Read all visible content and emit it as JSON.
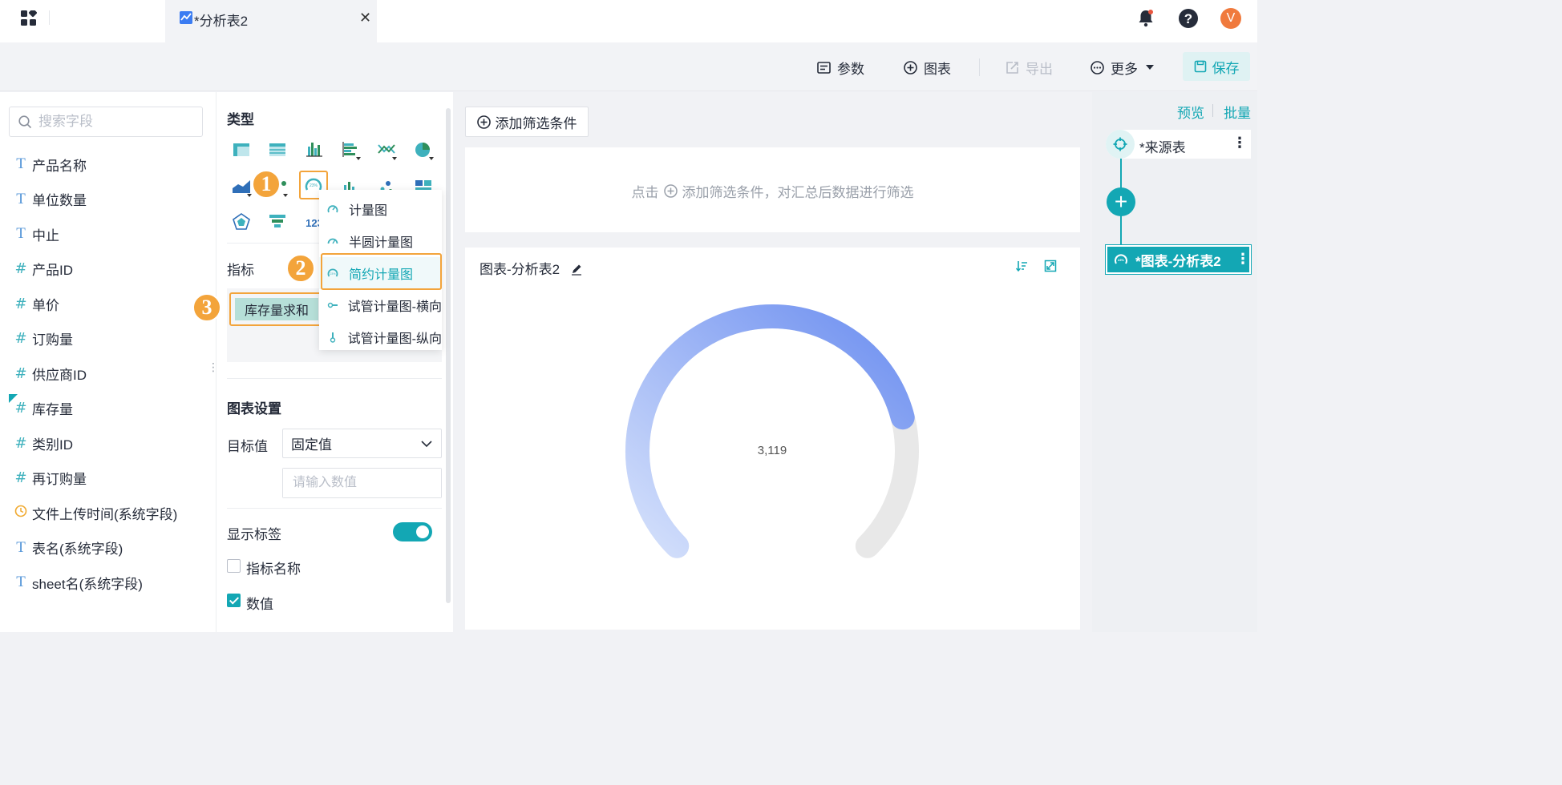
{
  "tab": {
    "title": "*分析表2"
  },
  "user": {
    "avatar_letter": "V"
  },
  "toolbar": {
    "params_label": "参数",
    "chart_label": "图表",
    "export_label": "导出",
    "more_label": "更多",
    "save_label": "保存"
  },
  "fields": {
    "search_placeholder": "搜索字段",
    "items": [
      {
        "type": "text",
        "label": "产品名称"
      },
      {
        "type": "text",
        "label": "单位数量"
      },
      {
        "type": "text",
        "label": "中止"
      },
      {
        "type": "number",
        "label": "产品ID"
      },
      {
        "type": "number",
        "label": "单价"
      },
      {
        "type": "number",
        "label": "订购量"
      },
      {
        "type": "number",
        "label": "供应商ID"
      },
      {
        "type": "number",
        "label": "库存量"
      },
      {
        "type": "number",
        "label": "类别ID"
      },
      {
        "type": "number",
        "label": "再订购量"
      },
      {
        "type": "time",
        "label": "文件上传时间(系统字段)"
      },
      {
        "type": "text",
        "label": "表名(系统字段)"
      },
      {
        "type": "text",
        "label": "sheet名(系统字段)"
      }
    ]
  },
  "config": {
    "type_title": "类型",
    "metric_title": "指标",
    "metric_chip": "库存量求和",
    "chart_settings_title": "图表设置",
    "target_label": "目标值",
    "target_value": "固定值",
    "number_placeholder": "请输入数值",
    "show_label_label": "显示标签",
    "metric_name_label": "指标名称",
    "value_label": "数值",
    "metric_name_checked": false,
    "value_checked": true,
    "show_label_on": true
  },
  "dropdown": {
    "items": [
      {
        "label": "计量图",
        "active": false
      },
      {
        "label": "半圆计量图",
        "active": false
      },
      {
        "label": "简约计量图",
        "active": true
      },
      {
        "label": "试管计量图-横向",
        "active": false
      },
      {
        "label": "试管计量图-纵向",
        "active": false
      }
    ]
  },
  "steps": [
    "1",
    "2",
    "3"
  ],
  "filter": {
    "add_label": "添加筛选条件",
    "hint_prefix": "点击",
    "hint_suffix": "添加筛选条件，对汇总后数据进行筛选"
  },
  "chart_data": {
    "type": "gauge",
    "title": "图表-分析表2",
    "value": 3119,
    "value_label": "3,119",
    "fill_fraction": 0.78,
    "colors": {
      "start": "#d4e0fb",
      "end": "#6d8ff0",
      "track": "#e8e8e8"
    }
  },
  "right": {
    "preview_label": "预览",
    "batch_label": "批量",
    "source_node": "*来源表",
    "chart_node": "*图表-分析表2"
  },
  "colors": {
    "accent": "#13a7b4",
    "highlight": "#f3a43b"
  }
}
